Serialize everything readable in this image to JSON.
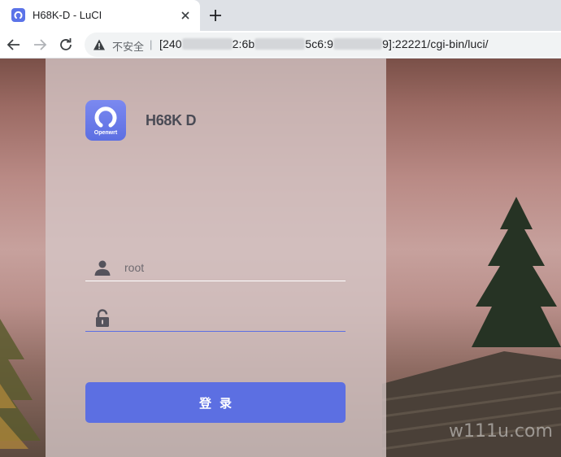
{
  "browser": {
    "tab": {
      "title": "H68K-D - LuCI"
    },
    "address": {
      "security_label": "不安全",
      "separator": "|",
      "url_part1": "[240",
      "url_part2": "2:6b",
      "url_part3": "5c6:9",
      "url_part4": "9]:22221/cgi-bin/luci/"
    }
  },
  "login": {
    "hostname": "H68K D",
    "logo_label": "Openwrt",
    "username_value": "root",
    "password_value": "",
    "submit_label": "登录"
  },
  "watermark": {
    "text": "w111u.com"
  },
  "colors": {
    "accent": "#5c6fe2",
    "panel": "#d4c6c6",
    "tabstrip": "#dee1e6"
  }
}
